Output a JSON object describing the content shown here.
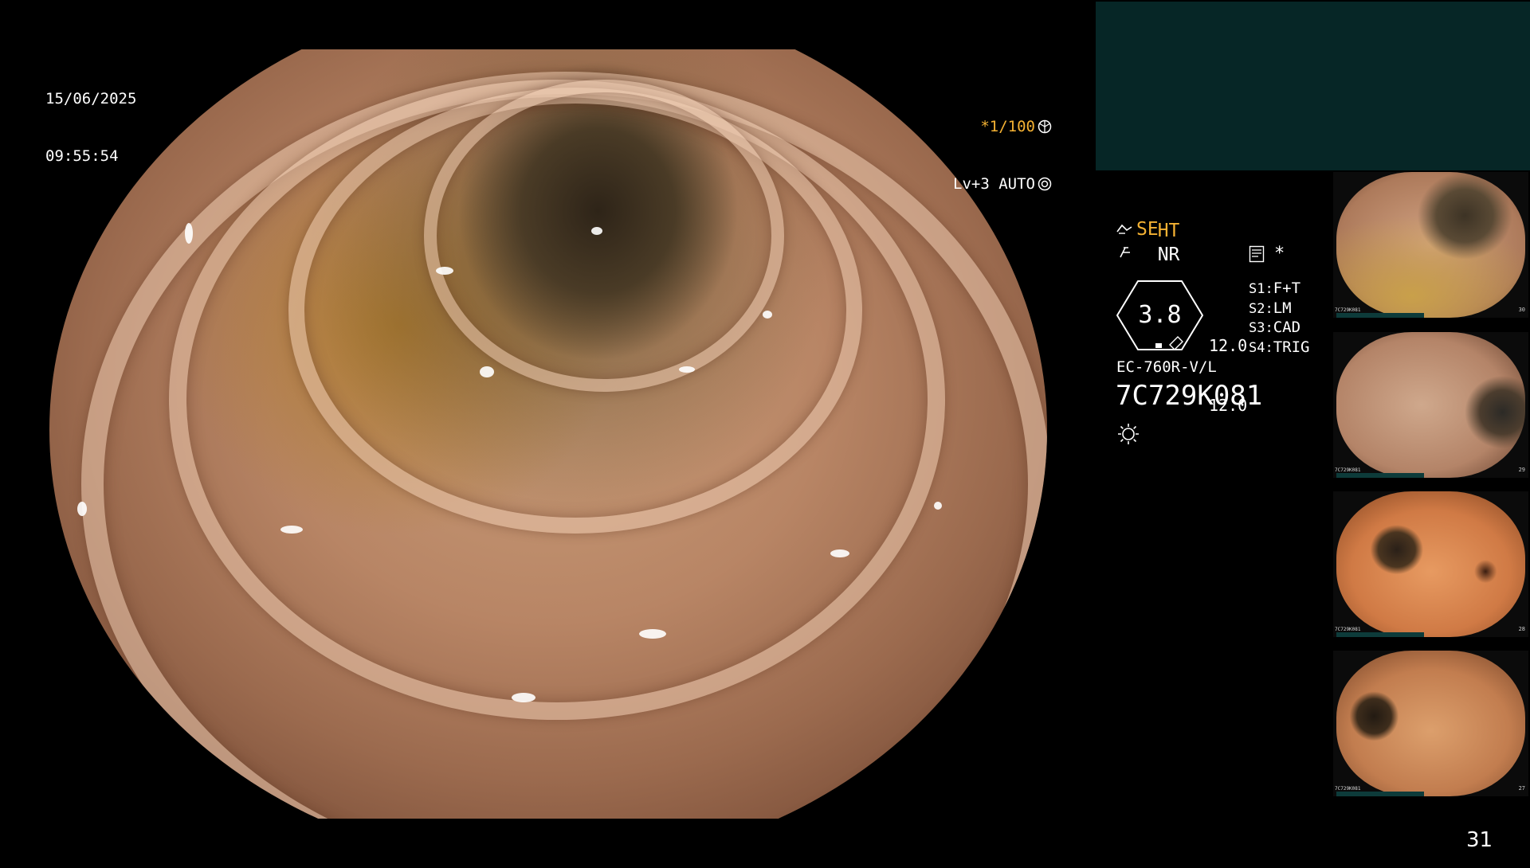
{
  "datetime": {
    "date": "15/06/2025",
    "time": "09:55:54"
  },
  "overlay": {
    "shutter": "*1/100",
    "level": "Lv+3 AUTO"
  },
  "processor": {
    "ht": "HT",
    "nr": "NR",
    "se": "SE",
    "star": "*",
    "dial_value": "3.8",
    "values": [
      "12.0",
      "12.0"
    ],
    "switches": [
      {
        "key": "S1:",
        "value": "F+T"
      },
      {
        "key": "S2:",
        "value": "LM"
      },
      {
        "key": "S3:",
        "value": "CAD"
      },
      {
        "key": "S4:",
        "value": "TRIG"
      }
    ],
    "model": "EC-760R-V/L",
    "serial": "7C729K081"
  },
  "thumbnails": [
    {
      "label": "7C729K081",
      "num": "30"
    },
    {
      "label": "7C729K081",
      "num": "29"
    },
    {
      "label": "7C729K081",
      "num": "28"
    },
    {
      "label": "7C729K081",
      "num": "27"
    }
  ],
  "page_number": "31",
  "colors": {
    "accent_orange": "#f5b233",
    "panel_teal": "#062626"
  },
  "icons": [
    "aperture-icon",
    "gear-icon",
    "scope-icon",
    "lightning-icon",
    "memory-icon",
    "light-bulb-icon"
  ]
}
